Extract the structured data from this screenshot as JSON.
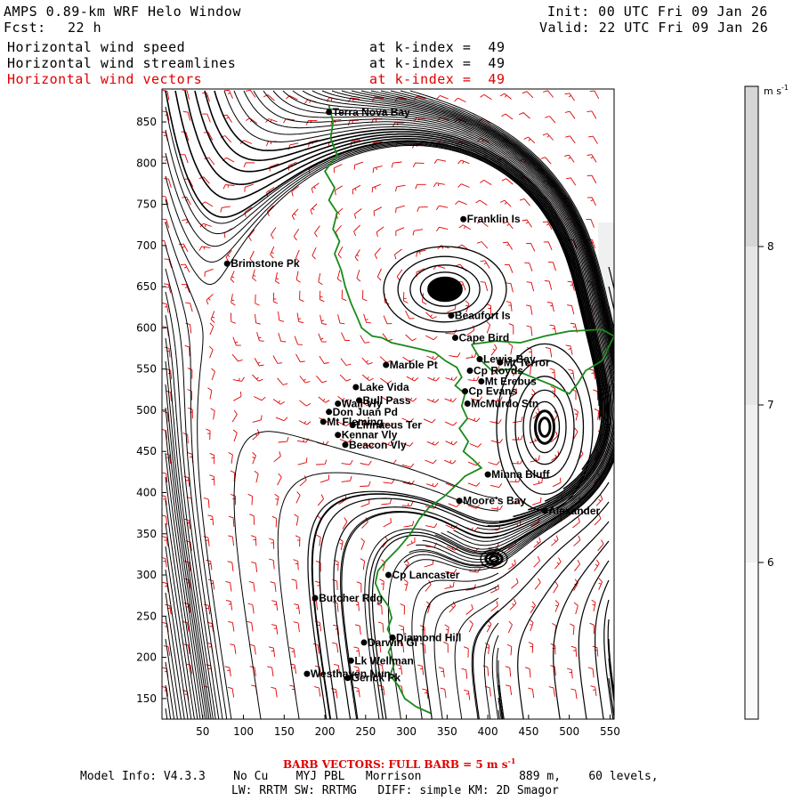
{
  "header": {
    "title": "AMPS 0.89-km WRF Helo Window",
    "forecast_label": "Fcst:",
    "forecast_hours": "22 h",
    "init": "Init: 00 UTC Fri 09 Jan 26",
    "valid": "Valid: 22 UTC Fri 09 Jan 26",
    "fields": [
      {
        "name": "Horizontal wind speed",
        "level": "at k-index =  49",
        "color": "#000000"
      },
      {
        "name": "Horizontal wind streamlines",
        "level": "at k-index =  49",
        "color": "#000000"
      },
      {
        "name": "Horizontal wind vectors",
        "level": "at k-index =  49",
        "color": "#e00000"
      }
    ]
  },
  "map": {
    "x_axis_ticks": [
      "50",
      "100",
      "150",
      "200",
      "250",
      "300",
      "350",
      "400",
      "450",
      "500",
      "550"
    ],
    "y_axis_ticks": [
      "850",
      "800",
      "750",
      "700",
      "650",
      "600",
      "550",
      "500",
      "450",
      "400",
      "350",
      "300",
      "250",
      "200",
      "150"
    ],
    "x_range": [
      0,
      555
    ],
    "y_range": [
      125,
      890
    ],
    "coastline_color": "#1a8a1a",
    "streamline_color": "#000000",
    "vector_color": "#e00000",
    "places": [
      {
        "name": "Terra Nova Bay",
        "x": 205,
        "y": 862
      },
      {
        "name": "Franklin Is",
        "x": 370,
        "y": 732
      },
      {
        "name": "Brimstone Pk",
        "x": 80,
        "y": 678
      },
      {
        "name": "Beaufort Is",
        "x": 355,
        "y": 615
      },
      {
        "name": "Cape Bird",
        "x": 360,
        "y": 588
      },
      {
        "name": "Marble Pt",
        "x": 275,
        "y": 555
      },
      {
        "name": "Lewis Bay",
        "x": 390,
        "y": 562
      },
      {
        "name": "Mt Terror",
        "x": 415,
        "y": 558
      },
      {
        "name": "Cp Royds",
        "x": 378,
        "y": 548
      },
      {
        "name": "Mt Erebus",
        "x": 392,
        "y": 535
      },
      {
        "name": "Lake Vida",
        "x": 238,
        "y": 528
      },
      {
        "name": "Cp Evans",
        "x": 372,
        "y": 523
      },
      {
        "name": "Wall Vly",
        "x": 216,
        "y": 508
      },
      {
        "name": "Bull Pass",
        "x": 242,
        "y": 512
      },
      {
        "name": "McMurdo Stn",
        "x": 375,
        "y": 508
      },
      {
        "name": "Don Juan Pd",
        "x": 205,
        "y": 498
      },
      {
        "name": "Mt Fleming",
        "x": 198,
        "y": 486
      },
      {
        "name": "Linnaeus Ter",
        "x": 234,
        "y": 482
      },
      {
        "name": "Kennar Vly",
        "x": 216,
        "y": 470
      },
      {
        "name": "Beacon Vly",
        "x": 225,
        "y": 458
      },
      {
        "name": "Minna Bluff",
        "x": 400,
        "y": 422
      },
      {
        "name": "Moore's Bay",
        "x": 365,
        "y": 390
      },
      {
        "name": "Alexander",
        "x": 470,
        "y": 378
      },
      {
        "name": "Cp Lancaster",
        "x": 278,
        "y": 300
      },
      {
        "name": "Butcher Rdg",
        "x": 188,
        "y": 272
      },
      {
        "name": "Darwin Gl",
        "x": 248,
        "y": 218
      },
      {
        "name": "Diamond Hill",
        "x": 283,
        "y": 224
      },
      {
        "name": "Lk Wellman",
        "x": 232,
        "y": 196
      },
      {
        "name": "Westhaven Nun",
        "x": 178,
        "y": 180
      },
      {
        "name": "Gerick Pk",
        "x": 228,
        "y": 175
      }
    ]
  },
  "colorbar": {
    "units": "m s",
    "units_exp": "-1",
    "ticks": [
      "8",
      "7",
      "6"
    ],
    "colors": [
      "#d6d6d6",
      "#e6e6e6",
      "#f0f0f0",
      "#fafafa"
    ]
  },
  "footer": {
    "barb_note": "BARB VECTORS:  FULL BARB = 5 m s",
    "barb_note_exp": "-1",
    "line1": "Model Info: V4.3.3    No Cu    MYJ PBL   Morrison              889 m,    60 levels,",
    "line2": "LW: RRTM SW: RRTMG   DIFF: simple KM: 2D Smagor"
  }
}
